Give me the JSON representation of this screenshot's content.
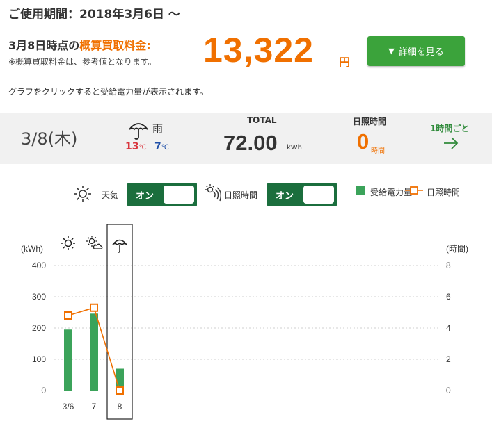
{
  "header": {
    "period": "ご使用期間：2018年3月6日 ～",
    "fee_label_prefix": "3月8日時点の",
    "fee_label_highlight": "概算買取料金:",
    "fee_note": "※概算買取料金は、参考値となります。",
    "fee_value": "13,322",
    "fee_unit": "円",
    "detail_button": "詳細を見る",
    "detail_button_marker": "▼",
    "hint": "グラフをクリックすると受給電力量が表示されます。"
  },
  "info": {
    "date": "3/8(木)",
    "weather_label": "雨",
    "weather_icon": "umbrella-icon",
    "temp_high": "13",
    "temp_low": "7",
    "temp_unit": "℃",
    "total_label": "TOTAL",
    "total_value": "72.00",
    "total_unit": "kWh",
    "sunshine_label": "日照時間",
    "sunshine_value": "0",
    "sunshine_unit": "時間",
    "hourly_link": "1時間ごと"
  },
  "toggles": {
    "weather_label": "天気",
    "weather_state": "オン",
    "sunshine_label": "日照時間",
    "sunshine_state": "オン"
  },
  "legend": {
    "power": "受給電力量",
    "sunshine": "日照時間"
  },
  "colors": {
    "accent_orange": "#f07000",
    "green_button": "#3ba33b",
    "toggle_green": "#1b6e3d",
    "bar_green": "#3ba35a",
    "temp_high": "#d9363e",
    "temp_low": "#1f4fa8"
  },
  "chart_data": {
    "type": "bar",
    "categories": [
      "3/6",
      "7",
      "8"
    ],
    "weather_icons": [
      "sun-icon",
      "sun-cloud-icon",
      "umbrella-icon"
    ],
    "selected_index": 2,
    "ylabel": "(kWh)",
    "ylabel_right": "(時間)",
    "ylim": [
      0,
      400
    ],
    "yticks": [
      0,
      100,
      200,
      300,
      400
    ],
    "ylim_right": [
      0,
      8
    ],
    "yticks_right": [
      0,
      2,
      4,
      6,
      8
    ],
    "series": [
      {
        "name": "受給電力量",
        "type": "bar",
        "axis": "left",
        "values": [
          195,
          246,
          70
        ]
      },
      {
        "name": "日照時間",
        "type": "line",
        "axis": "right",
        "values": [
          4.8,
          5.3,
          0
        ]
      }
    ],
    "grid": true,
    "legend_position": "top-right"
  }
}
